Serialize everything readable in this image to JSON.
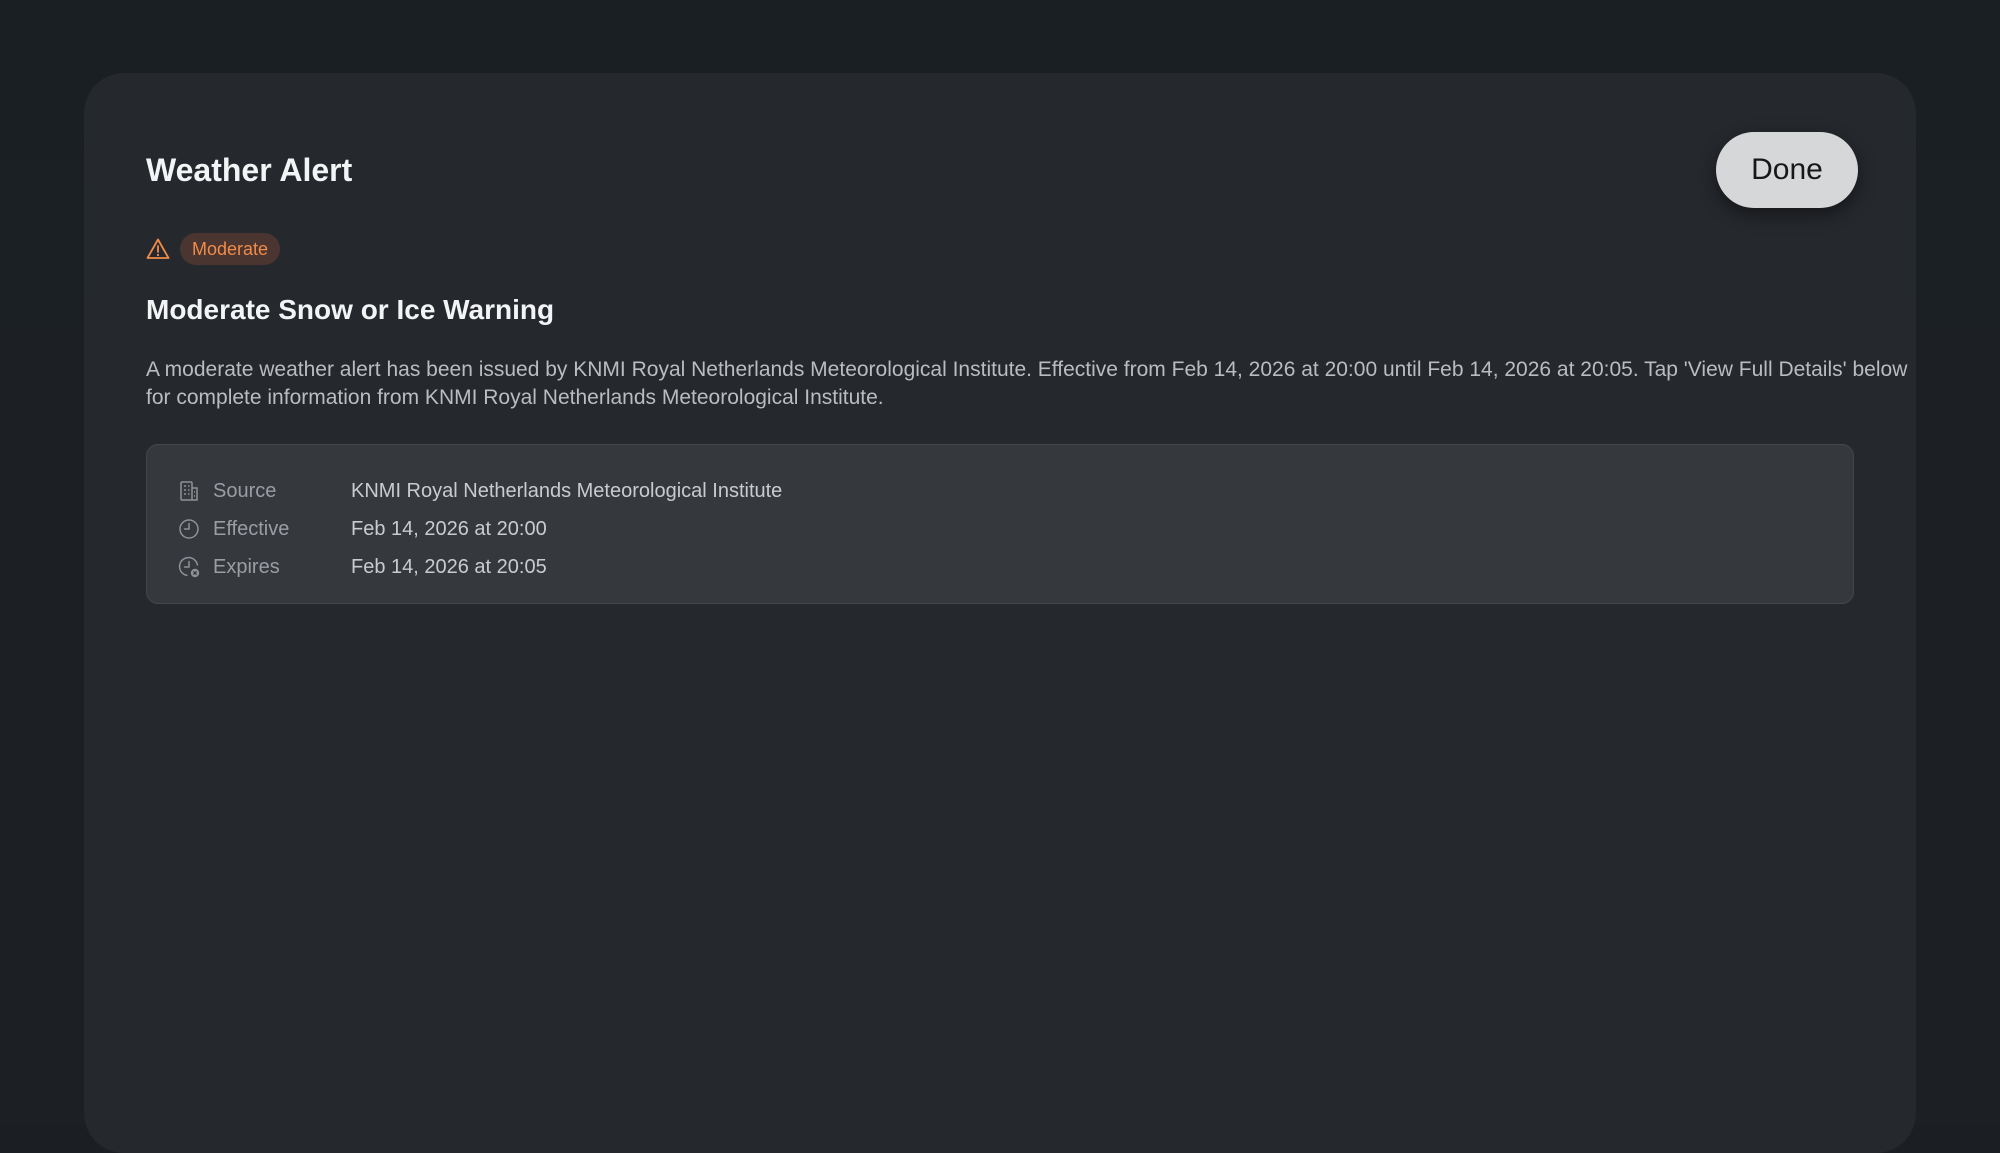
{
  "sheet": {
    "title": "Weather Alert",
    "done_label": "Done"
  },
  "alert": {
    "severity": "Moderate",
    "headline": "Moderate Snow or Ice Warning",
    "description": "A moderate weather alert has been issued by KNMI Royal Netherlands Meteorological Institute. Effective from Feb 14, 2026 at 20:00 until Feb 14, 2026 at 20:05. Tap 'View Full Details' below for complete information from KNMI Royal Netherlands Meteorological Institute.",
    "details": [
      {
        "icon": "building-icon",
        "label": "Source",
        "value": "KNMI Royal Netherlands Meteorological Institute"
      },
      {
        "icon": "clock-icon",
        "label": "Effective",
        "value": "Feb 14, 2026 at 20:00"
      },
      {
        "icon": "clock-expired-icon",
        "label": "Expires",
        "value": "Feb 14, 2026 at 20:05"
      }
    ]
  },
  "colors": {
    "severity_accent": "#f08c4a",
    "sheet_background": "#25282d",
    "card_background": "#35383d"
  }
}
